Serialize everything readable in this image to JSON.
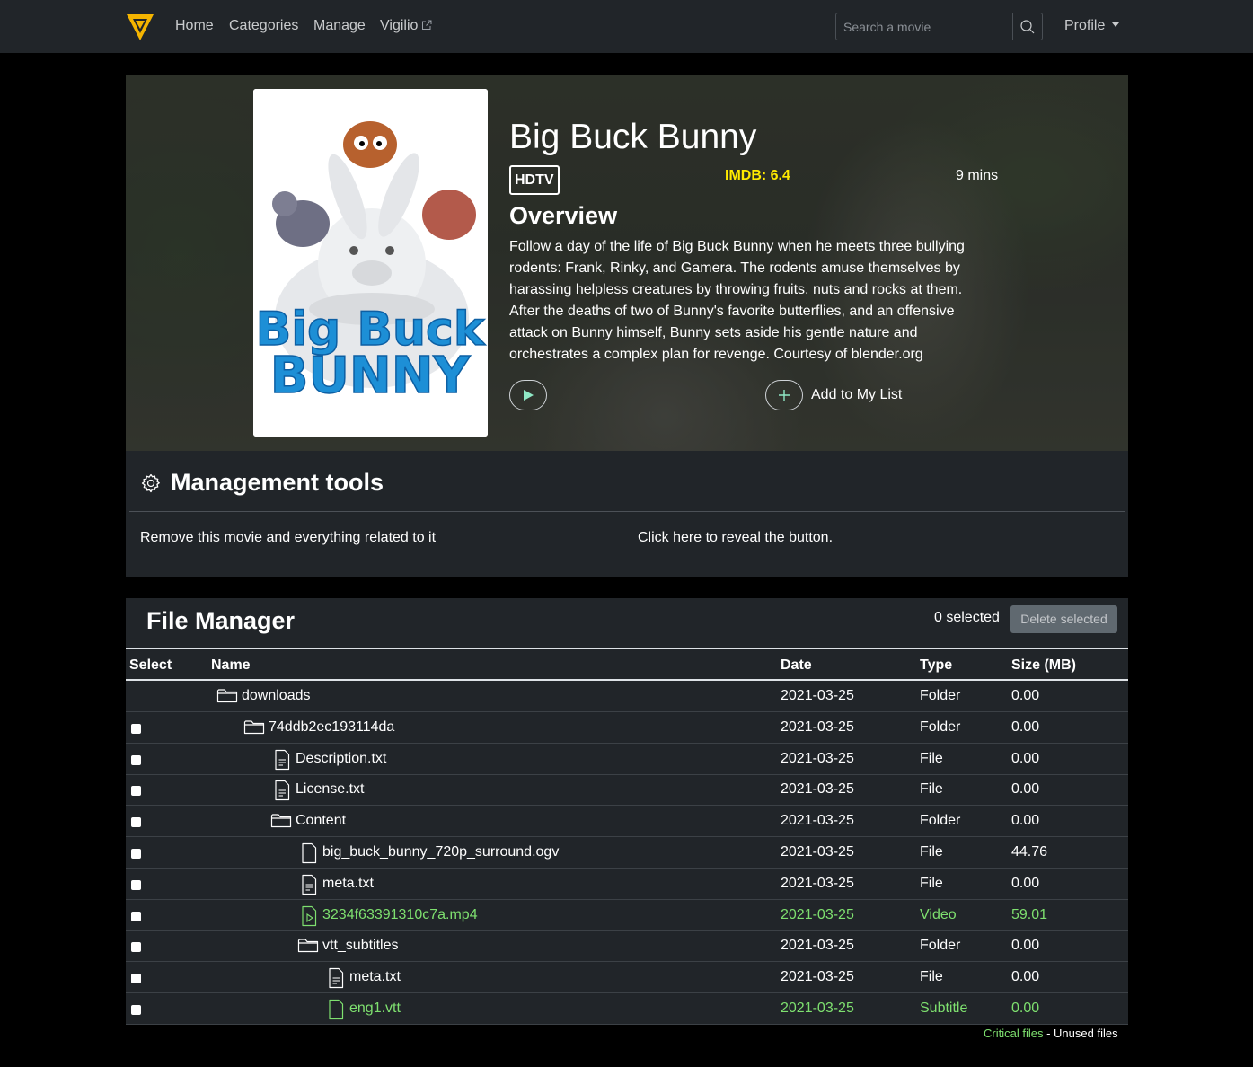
{
  "nav": {
    "links": [
      "Home",
      "Categories",
      "Manage",
      "Vigilio"
    ],
    "search_placeholder": "Search a movie",
    "profile": "Profile"
  },
  "movie": {
    "title": "Big Buck Bunny",
    "quality": "HDTV",
    "imdb": "IMDB: 6.4",
    "runtime": "9 mins",
    "overview_heading": "Overview",
    "overview": "Follow a day of the life of Big Buck Bunny when he meets three bullying rodents: Frank, Rinky, and Gamera. The rodents amuse themselves by harassing helpless creatures by throwing fruits, nuts and rocks at them. After the deaths of two of Bunny's favorite butterflies, and an offensive attack on Bunny himself, Bunny sets aside his gentle nature and orchestrates a complex plan for revenge.  Courtesy of blender.org",
    "add_label": "Add to My List",
    "poster_text": [
      "Big Buck",
      "BUNNY"
    ]
  },
  "management": {
    "title": "Management tools",
    "remove_label": "Remove this movie and everything related to it",
    "reveal_label": "Click here to reveal the button."
  },
  "file_manager": {
    "title": "File Manager",
    "selected": "0 selected",
    "delete_label": "Delete selected",
    "columns": [
      "Select",
      "Name",
      "Date",
      "Type",
      "Size (MB)"
    ],
    "rows": [
      {
        "name": "downloads",
        "date": "2021-03-25",
        "type": "Folder",
        "size": "0.00",
        "icon": "folder-icon",
        "depth": 0,
        "checkbox": false,
        "highlight": false
      },
      {
        "name": "74ddb2ec193114da",
        "date": "2021-03-25",
        "type": "Folder",
        "size": "0.00",
        "icon": "folder-icon",
        "depth": 1,
        "checkbox": true,
        "highlight": false
      },
      {
        "name": "Description.txt",
        "date": "2021-03-25",
        "type": "File",
        "size": "0.00",
        "icon": "text-file-icon",
        "depth": 2,
        "checkbox": true,
        "highlight": false
      },
      {
        "name": "License.txt",
        "date": "2021-03-25",
        "type": "File",
        "size": "0.00",
        "icon": "text-file-icon",
        "depth": 2,
        "checkbox": true,
        "highlight": false
      },
      {
        "name": "Content",
        "date": "2021-03-25",
        "type": "Folder",
        "size": "0.00",
        "icon": "folder-icon",
        "depth": 2,
        "checkbox": true,
        "highlight": false
      },
      {
        "name": "big_buck_bunny_720p_surround.ogv",
        "date": "2021-03-25",
        "type": "File",
        "size": "44.76",
        "icon": "file-icon",
        "depth": 3,
        "checkbox": true,
        "highlight": false
      },
      {
        "name": "meta.txt",
        "date": "2021-03-25",
        "type": "File",
        "size": "0.00",
        "icon": "text-file-icon",
        "depth": 3,
        "checkbox": true,
        "highlight": false
      },
      {
        "name": "3234f63391310c7a.mp4",
        "date": "2021-03-25",
        "type": "Video",
        "size": "59.01",
        "icon": "video-file-icon",
        "depth": 3,
        "checkbox": true,
        "highlight": true
      },
      {
        "name": "vtt_subtitles",
        "date": "2021-03-25",
        "type": "Folder",
        "size": "0.00",
        "icon": "folder-icon",
        "depth": 3,
        "checkbox": true,
        "highlight": false
      },
      {
        "name": "meta.txt",
        "date": "2021-03-25",
        "type": "File",
        "size": "0.00",
        "icon": "text-file-icon",
        "depth": 4,
        "checkbox": true,
        "highlight": false
      },
      {
        "name": "eng1.vtt",
        "date": "2021-03-25",
        "type": "Subtitle",
        "size": "0.00",
        "icon": "file-icon",
        "depth": 4,
        "checkbox": true,
        "highlight": true
      }
    ],
    "legend": {
      "critical": "Critical files",
      "separator": " - ",
      "unused": "Unused files"
    }
  },
  "colors": {
    "navbar": "#212529",
    "imdb": "#ffea00",
    "critical": "#7ee06f",
    "poster_text": "#1d8fd6"
  }
}
